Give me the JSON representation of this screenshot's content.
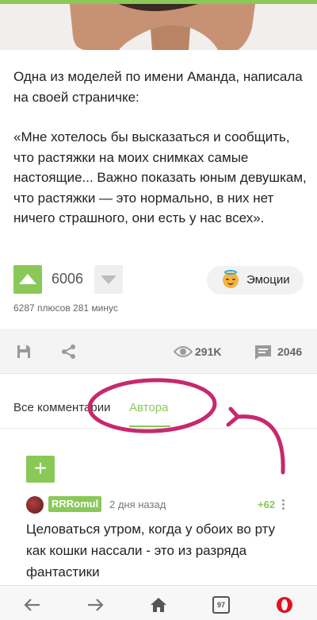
{
  "article": {
    "paragraph1": "Одна из моделей по имени Аманда, написала на своей страничке:",
    "paragraph2": "«Мне хотелось бы высказаться и сообщить, что растяжки на моих снимках самые настоящие... Важно показать юным девушкам, что растяжки — это нормально, в них нет ничего страшного, они есть у нас всех»."
  },
  "votes": {
    "rating": "6006",
    "detail": "6287 плюсов 281 минус",
    "emotions_label": "Эмоции"
  },
  "actions": {
    "views": "291K",
    "comments": "2046"
  },
  "tabs": {
    "all_label": "Все комментарии",
    "author_label": "Автора",
    "active": "Автора"
  },
  "comment": {
    "username": "RRRomul",
    "time": "2 дня назад",
    "rating": "+62",
    "text": "Целоваться утром, когда у обоих во рту как кошки нассали - это из разряда фантастики"
  },
  "nav": {
    "tabs_count": "97"
  },
  "colors": {
    "accent": "#8ac858",
    "annotation": "#c8286e"
  },
  "icons": [
    "save-icon",
    "share-icon",
    "eye-icon",
    "comments-icon",
    "arrow-up-icon",
    "arrow-down-icon",
    "plus-icon",
    "more-icon",
    "back-icon",
    "forward-icon",
    "home-icon",
    "tabs-icon",
    "opera-icon"
  ]
}
